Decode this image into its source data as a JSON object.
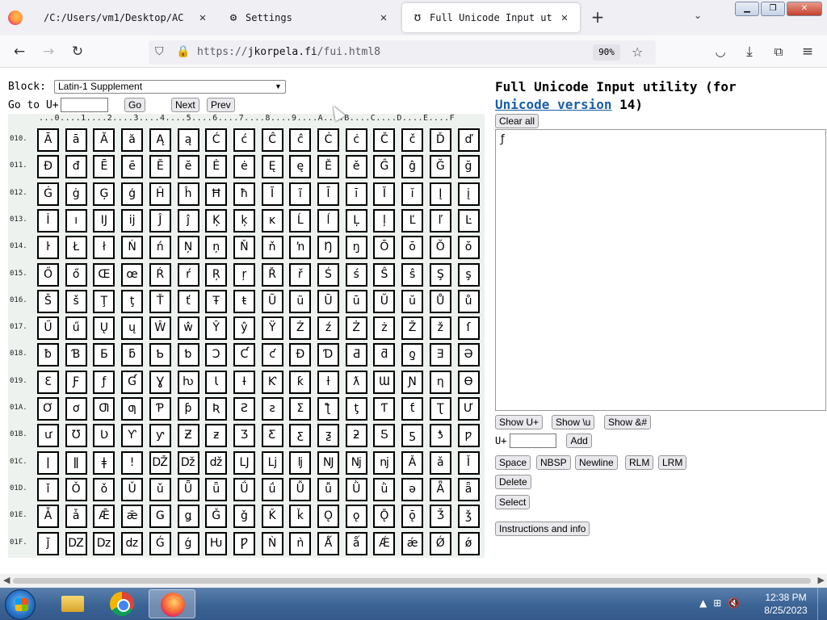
{
  "browser": {
    "tabs": [
      {
        "label": "/C:/Users/vm1/Desktop/AC",
        "icon": "firefox-icon"
      },
      {
        "label": "Settings",
        "icon": "gear-icon"
      },
      {
        "label": "Full Unicode Input ut",
        "icon": "unicode-icon"
      }
    ],
    "url_prefix": "https://",
    "url_domain": "jkorpela.fi",
    "url_path": "/fui.html8",
    "zoom": "90%",
    "window_buttons": [
      "minimize",
      "restore",
      "close"
    ]
  },
  "page": {
    "block_label": "Block:",
    "block_selected": "Latin-1 Supplement",
    "goto_label": "Go to U+",
    "goto_value": "",
    "go_button": "Go",
    "next_button": "Next",
    "prev_button": "Prev",
    "column_header": "...0....1....2....3....4....5....6....7....8....9....A....B....C....D....E....F",
    "rows": [
      {
        "label": "010.",
        "chars": [
          "Ā",
          "ā",
          "Ă",
          "ă",
          "Ą",
          "ą",
          "Ć",
          "ć",
          "Ĉ",
          "ĉ",
          "Ċ",
          "ċ",
          "Č",
          "č",
          "Ď",
          "ď"
        ]
      },
      {
        "label": "011.",
        "chars": [
          "Đ",
          "đ",
          "Ē",
          "ē",
          "Ĕ",
          "ĕ",
          "Ė",
          "ė",
          "Ę",
          "ę",
          "Ě",
          "ě",
          "Ĝ",
          "ĝ",
          "Ğ",
          "ğ"
        ]
      },
      {
        "label": "012.",
        "chars": [
          "Ġ",
          "ġ",
          "Ģ",
          "ģ",
          "Ĥ",
          "ĥ",
          "Ħ",
          "ħ",
          "Ĩ",
          "ĩ",
          "Ī",
          "ī",
          "Ĭ",
          "ĭ",
          "Į",
          "į"
        ]
      },
      {
        "label": "013.",
        "chars": [
          "İ",
          "ı",
          "Ĳ",
          "ĳ",
          "Ĵ",
          "ĵ",
          "Ķ",
          "ķ",
          "ĸ",
          "Ĺ",
          "ĺ",
          "Ļ",
          "ļ",
          "Ľ",
          "ľ",
          "Ŀ"
        ]
      },
      {
        "label": "014.",
        "chars": [
          "ŀ",
          "Ł",
          "ł",
          "Ń",
          "ń",
          "Ņ",
          "ņ",
          "Ň",
          "ň",
          "ŉ",
          "Ŋ",
          "ŋ",
          "Ō",
          "ō",
          "Ŏ",
          "ŏ"
        ]
      },
      {
        "label": "015.",
        "chars": [
          "Ő",
          "ő",
          "Œ",
          "œ",
          "Ŕ",
          "ŕ",
          "Ŗ",
          "ŗ",
          "Ř",
          "ř",
          "Ś",
          "ś",
          "Ŝ",
          "ŝ",
          "Ş",
          "ş"
        ]
      },
      {
        "label": "016.",
        "chars": [
          "Š",
          "š",
          "Ţ",
          "ţ",
          "Ť",
          "ť",
          "Ŧ",
          "ŧ",
          "Ũ",
          "ũ",
          "Ū",
          "ū",
          "Ŭ",
          "ŭ",
          "Ů",
          "ů"
        ]
      },
      {
        "label": "017.",
        "chars": [
          "Ű",
          "ű",
          "Ų",
          "ų",
          "Ŵ",
          "ŵ",
          "Ŷ",
          "ŷ",
          "Ÿ",
          "Ź",
          "ź",
          "Ż",
          "ż",
          "Ž",
          "ž",
          "ſ"
        ]
      },
      {
        "label": "018.",
        "chars": [
          "ƀ",
          "Ɓ",
          "Ƃ",
          "ƃ",
          "Ƅ",
          "ƅ",
          "Ɔ",
          "Ƈ",
          "ƈ",
          "Ɖ",
          "Ɗ",
          "Ƌ",
          "ƌ",
          "ƍ",
          "Ǝ",
          "Ə"
        ]
      },
      {
        "label": "019.",
        "chars": [
          "Ɛ",
          "Ƒ",
          "ƒ",
          "Ɠ",
          "Ɣ",
          "ƕ",
          "Ɩ",
          "Ɨ",
          "Ƙ",
          "ƙ",
          "ƚ",
          "ƛ",
          "Ɯ",
          "Ɲ",
          "ƞ",
          "Ɵ"
        ]
      },
      {
        "label": "01A.",
        "chars": [
          "Ơ",
          "ơ",
          "Ƣ",
          "ƣ",
          "Ƥ",
          "ƥ",
          "Ʀ",
          "Ƨ",
          "ƨ",
          "Ʃ",
          "ƪ",
          "ƫ",
          "Ƭ",
          "ƭ",
          "Ʈ",
          "Ư"
        ]
      },
      {
        "label": "01B.",
        "chars": [
          "ư",
          "Ʊ",
          "Ʋ",
          "Ƴ",
          "ƴ",
          "Ƶ",
          "ƶ",
          "Ʒ",
          "Ƹ",
          "ƹ",
          "ƺ",
          "ƻ",
          "Ƽ",
          "ƽ",
          "ƾ",
          "ƿ"
        ]
      },
      {
        "label": "01C.",
        "chars": [
          "ǀ",
          "ǁ",
          "ǂ",
          "ǃ",
          "Ǆ",
          "ǅ",
          "ǆ",
          "Ǉ",
          "ǈ",
          "ǉ",
          "Ǌ",
          "ǋ",
          "ǌ",
          "Ǎ",
          "ǎ",
          "Ǐ"
        ]
      },
      {
        "label": "01D.",
        "chars": [
          "ǐ",
          "Ǒ",
          "ǒ",
          "Ǔ",
          "ǔ",
          "Ǖ",
          "ǖ",
          "Ǘ",
          "ǘ",
          "Ǚ",
          "ǚ",
          "Ǜ",
          "ǜ",
          "ǝ",
          "Ǟ",
          "ǟ"
        ]
      },
      {
        "label": "01E.",
        "chars": [
          "Ǡ",
          "ǡ",
          "Ǣ",
          "ǣ",
          "Ǥ",
          "ǥ",
          "Ǧ",
          "ǧ",
          "Ǩ",
          "ǩ",
          "Ǫ",
          "ǫ",
          "Ǭ",
          "ǭ",
          "Ǯ",
          "ǯ"
        ]
      },
      {
        "label": "01F.",
        "chars": [
          "ǰ",
          "Ǳ",
          "ǲ",
          "ǳ",
          "Ǵ",
          "ǵ",
          "Ƕ",
          "Ƿ",
          "Ǹ",
          "ǹ",
          "Ǻ",
          "ǻ",
          "Ǽ",
          "ǽ",
          "Ǿ",
          "ǿ"
        ]
      }
    ],
    "title_line1": "Full Unicode Input utility (for",
    "title_link": "Unicode version",
    "title_version": "14)",
    "clear_all_button": "Clear all",
    "textarea_value": "ƒ",
    "show_uplus_button": "Show U+",
    "show_u_button": "Show \\u",
    "show_entity_button": "Show &#",
    "u_label": "U+",
    "u_value": "",
    "add_button": "Add",
    "space_button": "Space",
    "nbsp_button": "NBSP",
    "newline_button": "Newline",
    "rlm_button": "RLM",
    "lrm_button": "LRM",
    "delete_button": "Delete",
    "select_button": "Select",
    "instructions_button": "Instructions and info"
  },
  "taskbar": {
    "apps": [
      "start-button",
      "file-explorer",
      "chrome",
      "firefox"
    ],
    "time": "12:38 PM",
    "date": "8/25/2023"
  }
}
